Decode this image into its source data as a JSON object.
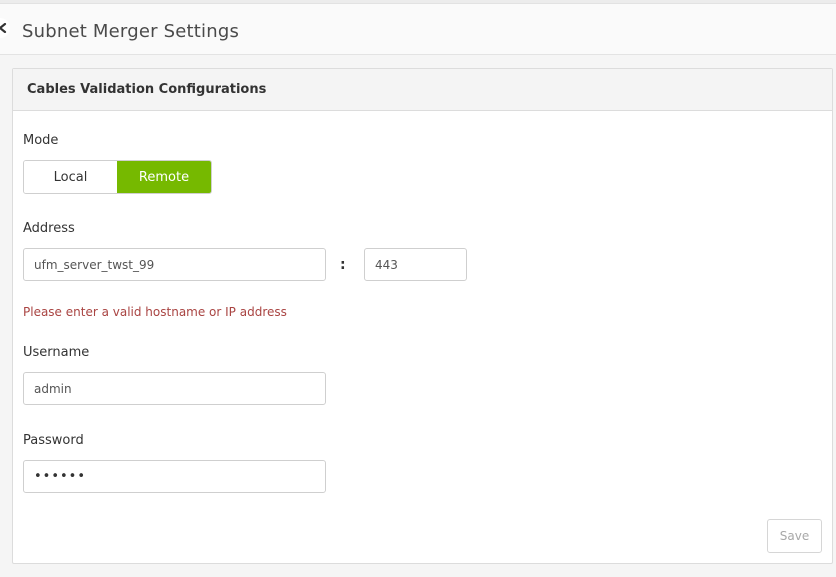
{
  "header": {
    "title": "Subnet Merger Settings"
  },
  "panel": {
    "title": "Cables Validation Configurations",
    "mode": {
      "label": "Mode",
      "options": [
        "Local",
        "Remote"
      ],
      "selected": "Remote"
    },
    "address": {
      "label": "Address",
      "host_value": "ufm_server_twst_99",
      "separator": ":",
      "port_value": "443",
      "error": "Please enter a valid hostname or IP address"
    },
    "username": {
      "label": "Username",
      "value": "admin"
    },
    "password": {
      "label": "Password",
      "value": "••••••"
    },
    "save_label": "Save"
  },
  "colors": {
    "accent": "#76b900",
    "error": "#a94442"
  },
  "icons": {
    "back": "back-arrow-icon"
  }
}
